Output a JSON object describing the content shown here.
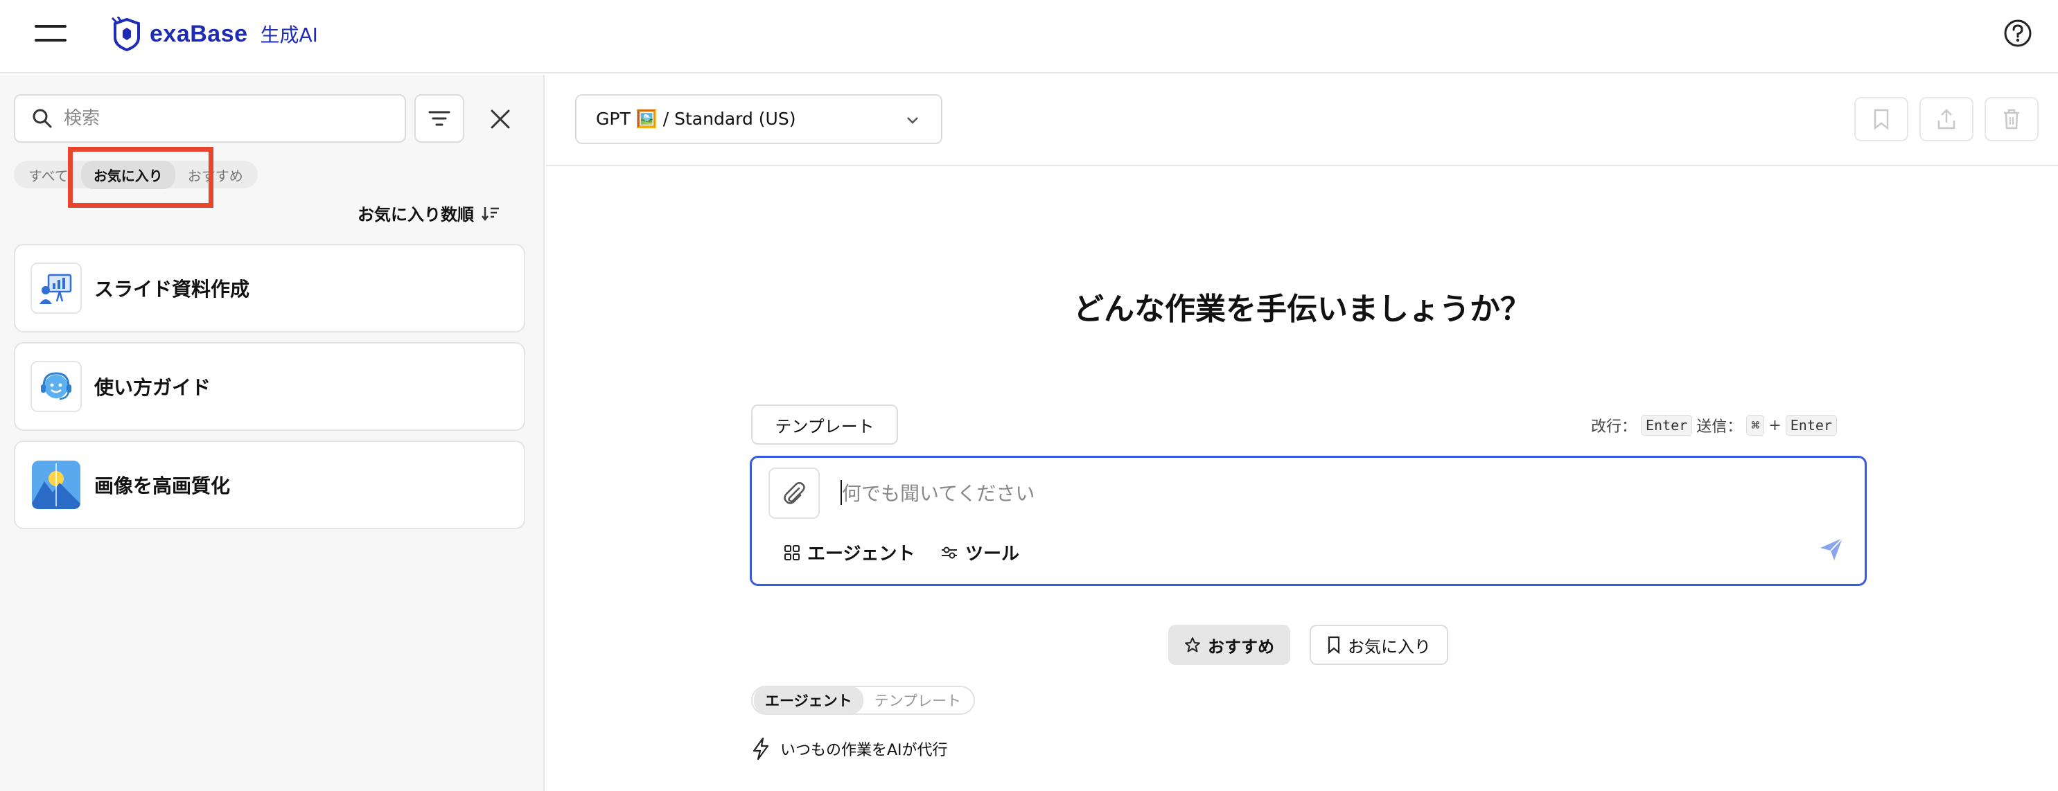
{
  "header": {
    "brand": "exaBase",
    "brand_suffix": "生成AI"
  },
  "sidebar": {
    "search_placeholder": "検索",
    "tabs": [
      {
        "label": "すべて",
        "active": false
      },
      {
        "label": "お気に入り",
        "active": true
      },
      {
        "label": "おすすめ",
        "active": false
      }
    ],
    "sort_label": "お気に入り数順",
    "items": [
      {
        "label": "スライド資料作成",
        "icon": "presentation-icon"
      },
      {
        "label": "使い方ガイド",
        "icon": "support-agent-icon"
      },
      {
        "label": "画像を高画質化",
        "icon": "mountain-image-icon"
      }
    ]
  },
  "main": {
    "model_label": "GPT 🖼️ / Standard (US)",
    "greeting": "どんな作業を手伝いましょうか？",
    "template_button": "テンプレート",
    "shortcuts": {
      "newline_label": "改行：",
      "newline_key": "Enter",
      "send_label": "送信：",
      "send_key_mod": "⌘",
      "plus": "+",
      "send_key": "Enter"
    },
    "composer": {
      "placeholder": "何でも聞いてください",
      "agent_label": "エージェント",
      "tool_label": "ツール"
    },
    "recommend_button": "おすすめ",
    "favorite_button": "お気に入り",
    "segment": [
      {
        "label": "エージェント",
        "active": true
      },
      {
        "label": "テンプレート",
        "active": false
      }
    ],
    "agent_description": "いつもの作業をAIが代行"
  },
  "colors": {
    "brand": "#1d2bb5",
    "focus_border": "#3a5bd9",
    "highlight": "#e8452f",
    "send_icon": "#8aa4ef"
  }
}
